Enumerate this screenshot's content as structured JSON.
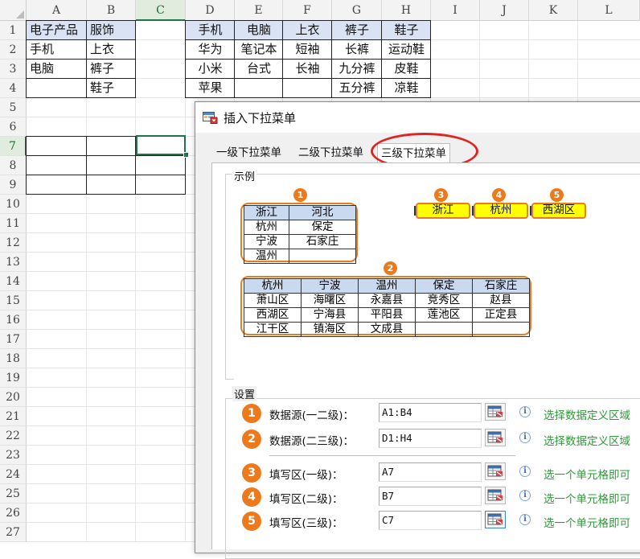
{
  "columns": [
    "A",
    "B",
    "C",
    "D",
    "E",
    "F",
    "G",
    "H",
    "I",
    "J",
    "K",
    "L"
  ],
  "rows": [
    "1",
    "2",
    "3",
    "4",
    "5",
    "6",
    "7",
    "8",
    "9",
    "10",
    "11",
    "12",
    "13",
    "14",
    "15",
    "16",
    "17",
    "18",
    "19",
    "20",
    "21",
    "22",
    "23",
    "24",
    "25",
    "26",
    "27"
  ],
  "cells": {
    "A1": "电子产品",
    "B1": "服饰",
    "A2": "手机",
    "B2": "上衣",
    "A3": "电脑",
    "B3": "裤子",
    "B4": "鞋子",
    "D1": "手机",
    "E1": "电脑",
    "F1": "上衣",
    "G1": "裤子",
    "H1": "鞋子",
    "D2": "华为",
    "E2": "笔记本",
    "F2": "短袖",
    "G2": "长裤",
    "H2": "运动鞋",
    "D3": "小米",
    "E3": "台式",
    "F3": "长袖",
    "G3": "九分裤",
    "H3": "皮鞋",
    "D4": "苹果",
    "G4": "五分裤",
    "H4": "凉鞋"
  },
  "dialog": {
    "title": "插入下拉菜单",
    "tabs": [
      "一级下拉菜单",
      "二级下拉菜单",
      "三级下拉菜单"
    ],
    "active_tab": "三级下拉菜单",
    "example_label": "示例",
    "settings_label": "设置",
    "example": {
      "table1": {
        "headers": [
          "浙江",
          "河北"
        ],
        "rows": [
          [
            "杭州",
            "保定"
          ],
          [
            "宁波",
            "石家庄"
          ],
          [
            "温州",
            ""
          ]
        ]
      },
      "table2": {
        "headers": [
          "杭州",
          "宁波",
          "温州",
          "保定",
          "石家庄"
        ],
        "rows": [
          [
            "萧山区",
            "海曙区",
            "永嘉县",
            "竞秀区",
            "赵县"
          ],
          [
            "西湖区",
            "宁海县",
            "平阳县",
            "莲池区",
            "正定县"
          ],
          [
            "江干区",
            "镇海区",
            "文成县",
            "",
            ""
          ]
        ]
      },
      "picks": [
        "浙江",
        "杭州",
        "西湖区"
      ],
      "badges": [
        "1",
        "2",
        "3",
        "4",
        "5"
      ]
    },
    "settings": [
      {
        "num": "1",
        "label": "数据源(一二级)：",
        "value": "A1:B4",
        "hint": "选择数据定义区域"
      },
      {
        "num": "2",
        "label": "数据源(二三级)：",
        "value": "D1:H4",
        "hint": "选择数据定义区域"
      },
      {
        "num": "3",
        "label": "填写区(一级)：",
        "value": "A7",
        "hint": "选一个单元格即可"
      },
      {
        "num": "4",
        "label": "填写区(二级)：",
        "value": "B7",
        "hint": "选一个单元格即可"
      },
      {
        "num": "5",
        "label": "填写区(三级)：",
        "value": "C7",
        "hint": "选一个单元格即可"
      }
    ],
    "info_glyph": "i"
  },
  "colors": {
    "header_fill": "#dae3f3",
    "accent_orange": "#ec7a1c",
    "highlight_yellow": "#ffff00",
    "hint_green": "#2f9a3a",
    "red_oval": "#e02424",
    "selection_green": "#217346"
  },
  "icons": [
    "range-picker-icon",
    "info-icon",
    "dialog-app-icon"
  ]
}
